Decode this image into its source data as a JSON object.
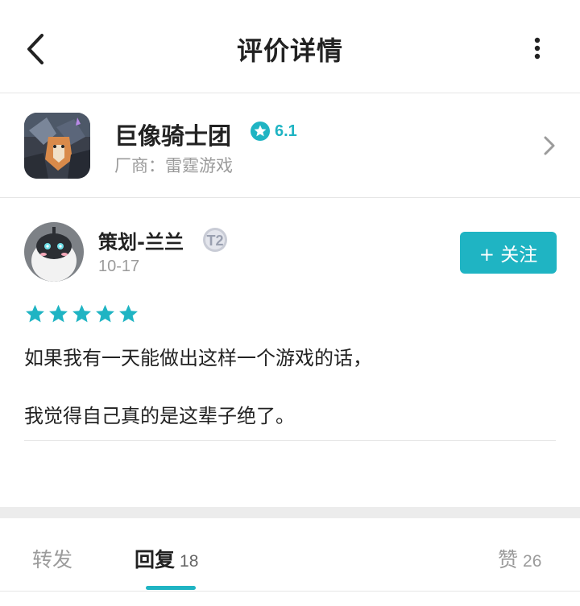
{
  "header": {
    "title": "评价详情",
    "back_icon": "chevron-left-icon",
    "more_icon": "more-vertical-icon"
  },
  "game": {
    "name": "巨像骑士团",
    "rating": "6.1",
    "vendor": "厂商：雷霆游戏",
    "icon": "game-app-icon"
  },
  "review": {
    "author": "策划-兰兰",
    "level_badge": "T2",
    "date": "10-17",
    "follow_label": "+ 关注",
    "stars": 5,
    "lines": [
      "如果我有一天能做出这样一个游戏的话，",
      "我觉得自己真的是这辈子绝了。"
    ]
  },
  "tabs": {
    "forward_label": "转发",
    "reply_label": "回复",
    "reply_count": "18",
    "like_label": "赞",
    "like_count": "26"
  },
  "colors": {
    "accent": "#1fb4c3",
    "muted_text": "#9b9b9b",
    "divider": "#e6e6e6"
  }
}
